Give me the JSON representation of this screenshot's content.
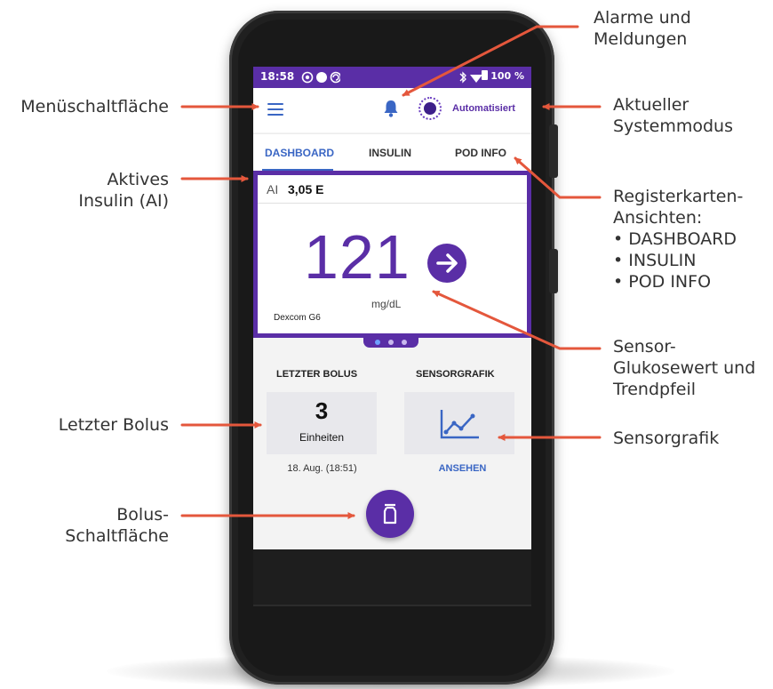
{
  "status_bar": {
    "time": "18:58",
    "battery": "100 %"
  },
  "app_bar": {
    "mode_label": "Automatisiert"
  },
  "tabs": [
    {
      "label": "DASHBOARD"
    },
    {
      "label": "INSULIN"
    },
    {
      "label": "POD INFO"
    }
  ],
  "dashboard": {
    "active_insulin_key": "AI",
    "active_insulin_value": "3,05 E",
    "glucose_value": "121",
    "glucose_unit": "mg/dL",
    "sensor_source": "Dexcom G6",
    "last_bolus_title": "LETZTER BOLUS",
    "last_bolus_value": "3",
    "last_bolus_unit": "Einheiten",
    "last_bolus_time": "18. Aug. (18:51)",
    "sensor_graph_title": "SENSORGRAFIK",
    "sensor_graph_link": "ANSEHEN"
  },
  "callouts": {
    "menu": "Menüschaltfläche",
    "ai_line1": "Aktives",
    "ai_line2": "Insulin (AI)",
    "last_bolus": "Letzter Bolus",
    "bolus_line1": "Bolus-",
    "bolus_line2": "Schaltfläche",
    "alarms_line1": "Alarme und",
    "alarms_line2": "Meldungen",
    "mode_line1": "Aktueller",
    "mode_line2": "Systemmodus",
    "tabs_line1": "Registerkarten-",
    "tabs_line2": "Ansichten:",
    "tabs_items": [
      "DASHBOARD",
      "INSULIN",
      "POD INFO"
    ],
    "sensor_line1": "Sensor-",
    "sensor_line2": "Glukosewert und",
    "sensor_line3": "Trendpfeil",
    "graph": "Sensorgrafik"
  },
  "colors": {
    "brand_purple": "#5a2ea6",
    "accent_blue": "#3a66c4",
    "callout_red": "#e4573c"
  }
}
